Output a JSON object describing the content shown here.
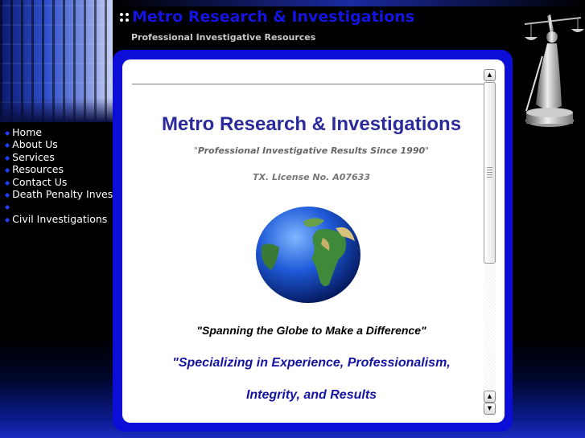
{
  "header": {
    "title": "Metro Research & Investigations",
    "subtitle": "Professional Investigative Resources"
  },
  "nav": {
    "items": [
      {
        "label": "Home"
      },
      {
        "label": "About Us"
      },
      {
        "label": "Services"
      },
      {
        "label": "Resources"
      },
      {
        "label": "Contact Us"
      },
      {
        "label": "Death Penalty Invest."
      },
      {
        "label": ""
      },
      {
        "label": "Civil Investigations"
      }
    ]
  },
  "main": {
    "title": "Metro Research & Investigations",
    "tagline_open": "\"",
    "tagline": "Professional Investigative Results Since 1990",
    "tagline_close": "\"",
    "license": "TX. License No. A07633",
    "slogan": "\"Spanning the Globe to Make a Difference\"",
    "specialty_line1": "\"Specializing in Experience, Professionalism,",
    "specialty_line2": "Integrity, and Results"
  },
  "colors": {
    "accent": "#1414e0",
    "frame": "#0d0dd8",
    "nav_bullet": "#2040ff"
  },
  "icons": {
    "title_dots": "four-dot-icon",
    "nav_bullet": "bullet-icon",
    "globe": "globe-icon"
  }
}
